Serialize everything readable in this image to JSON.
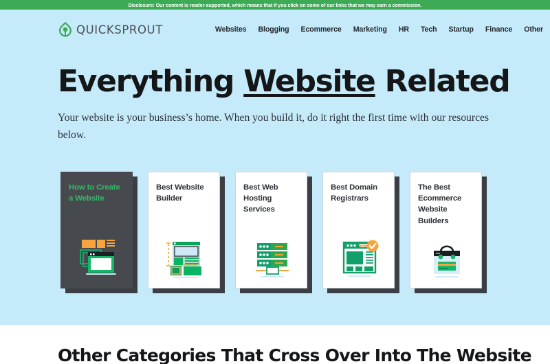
{
  "disclosure": {
    "text": "Disclosure: Our content is reader-supported, which means that if you click on some of our links that we may earn a commission.",
    "bg_color": "#3daa55",
    "text_color": "#ffffff"
  },
  "theme": {
    "hero_bg": "#c5eafa",
    "brand_green": "#3daa55",
    "card_dark": "#464a4f",
    "card_dark_title": "#37b86a",
    "accent_orange": "#f5a33c",
    "page_bg": "#ffffff"
  },
  "header": {
    "logo": {
      "icon": "sprout-leaf-icon",
      "text": "QUICKSPROUT"
    },
    "nav": [
      {
        "label": "Websites"
      },
      {
        "label": "Blogging"
      },
      {
        "label": "Ecommerce"
      },
      {
        "label": "Marketing"
      },
      {
        "label": "HR"
      },
      {
        "label": "Tech"
      },
      {
        "label": "Startup"
      },
      {
        "label": "Finance"
      },
      {
        "label": "Other"
      }
    ]
  },
  "hero": {
    "headline_before": "Everything ",
    "headline_highlight": "Website",
    "headline_after": " Related",
    "subhead": "Your website is your business’s home. When you build it, do it right the first time with our resources below."
  },
  "cards": [
    {
      "title": "How to Create a Website",
      "style": "dark",
      "art": "browser-windows-icon"
    },
    {
      "title": "Best Website Builder",
      "style": "light",
      "art": "page-builder-icon"
    },
    {
      "title": "Best Web Hosting Services",
      "style": "light",
      "art": "server-rack-icon"
    },
    {
      "title": "Best Domain Registrars",
      "style": "light",
      "art": "www-browser-check-icon"
    },
    {
      "title": "The Best Ecommerce Website Builders",
      "style": "light",
      "art": "shopping-bag-icon"
    }
  ],
  "bottom": {
    "heading": "Other Categories That Cross Over Into The Website"
  }
}
